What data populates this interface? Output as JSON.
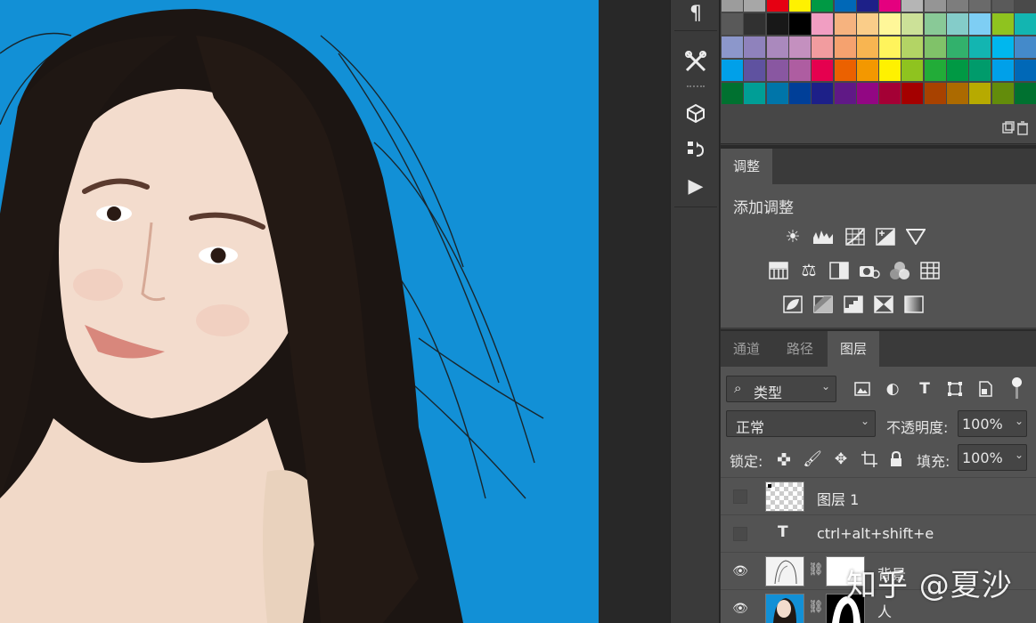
{
  "swatches": {
    "rows": [
      [
        "#9c9c9c",
        "#a7a7a7",
        "#e60012",
        "#fff100",
        "#009944",
        "#0068b7",
        "#1d2088",
        "#e4007f",
        "#b5b5b5",
        "#959595",
        "#7d7d7d",
        "#6a6a6a",
        "#5a5a5a",
        "#4a4a4a"
      ],
      [
        "#595959",
        "#313131",
        "#181818",
        "#000000",
        "#f19ec2",
        "#f6b37f",
        "#facd89",
        "#fff799",
        "#cce198",
        "#89c997",
        "#84ccc9",
        "#7ecef4",
        "#8fc31f",
        "#13b5b1"
      ],
      [
        "#8c97cb",
        "#8f82bc",
        "#aa89bd",
        "#c490bf",
        "#f29c9f",
        "#f5a26f",
        "#f8b551",
        "#fff45c",
        "#b3d465",
        "#80c269",
        "#32b16c",
        "#13b5b1",
        "#00b7ee",
        "#448aca"
      ],
      [
        "#00a0e9",
        "#5f52a0",
        "#8957a1",
        "#ae5da1",
        "#e5004f",
        "#eb6100",
        "#f39800",
        "#fff100",
        "#8fc31f",
        "#22ac38",
        "#009944",
        "#009b6b",
        "#00a0e9",
        "#0068b7"
      ],
      [
        "#007130",
        "#009e96",
        "#0075a9",
        "#003f98",
        "#1d2088",
        "#601986",
        "#920783",
        "#a40035",
        "#a40000",
        "#a84200",
        "#ac6a00",
        "#b7aa00",
        "#638c0b",
        "#007130"
      ]
    ]
  },
  "toolstrip": {
    "icons": [
      "pilcrow-icon",
      "tools-cross-icon",
      "cube-icon",
      "history-icon",
      "play-icon"
    ]
  },
  "adjustments": {
    "tab_label": "调整",
    "title": "添加调整"
  },
  "layers": {
    "tabs": [
      "通道",
      "路径",
      "图层"
    ],
    "active_tab": "图层",
    "filter_label": "类型",
    "blend_mode": "正常",
    "opacity_label": "不透明度:",
    "opacity_value": "100%",
    "lock_label": "锁定:",
    "fill_label": "填充:",
    "fill_value": "100%",
    "items": [
      {
        "name": "图层 1",
        "visible": false
      },
      {
        "name": "ctrl+alt+shift+e",
        "visible": false
      },
      {
        "name": "背景",
        "visible": true
      },
      {
        "name": "人",
        "visible": true
      }
    ]
  },
  "watermark": "知乎 @夏沙"
}
